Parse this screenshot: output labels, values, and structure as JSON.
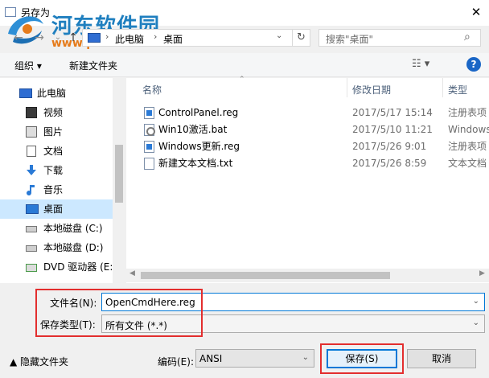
{
  "window": {
    "title": "另存为",
    "close_glyph": "✕"
  },
  "watermark": {
    "name": "河东软件园",
    "url": "www.pc0359.cn"
  },
  "nav": {
    "back_glyph": "←",
    "forward_glyph": "→",
    "up_glyph": "↑",
    "breadcrumb": [
      "此电脑",
      "桌面"
    ],
    "chevron": "›",
    "refresh_glyph": "↻",
    "search_placeholder": "搜索\"桌面\"",
    "search_glyph": "⌕"
  },
  "toolbar": {
    "organize": "组织 ▾",
    "new_folder": "新建文件夹",
    "view_glyph": "☷ ▾",
    "help": "?"
  },
  "sidebar": {
    "items": [
      {
        "label": "此电脑",
        "icon": "computer-icon"
      },
      {
        "label": "视频",
        "icon": "video-icon"
      },
      {
        "label": "图片",
        "icon": "picture-icon"
      },
      {
        "label": "文档",
        "icon": "document-icon"
      },
      {
        "label": "下载",
        "icon": "download-icon"
      },
      {
        "label": "音乐",
        "icon": "music-icon"
      },
      {
        "label": "桌面",
        "icon": "desktop-icon"
      },
      {
        "label": "本地磁盘 (C:)",
        "icon": "drive-icon"
      },
      {
        "label": "本地磁盘 (D:)",
        "icon": "drive-icon"
      },
      {
        "label": "DVD 驱动器 (E:)",
        "icon": "dvd-icon"
      }
    ],
    "selected": "桌面"
  },
  "files": {
    "columns": [
      "名称",
      "修改日期",
      "类型"
    ],
    "rows": [
      {
        "name": "ControlPanel.reg",
        "date": "2017/5/17 15:14",
        "type": "注册表项",
        "icon": "reg"
      },
      {
        "name": "Win10激活.bat",
        "date": "2017/5/10 11:21",
        "type": "Windows",
        "icon": "bat"
      },
      {
        "name": "Windows更新.reg",
        "date": "2017/5/26 9:01",
        "type": "注册表项",
        "icon": "reg"
      },
      {
        "name": "新建文本文档.txt",
        "date": "2017/5/26 8:59",
        "type": "文本文档",
        "icon": "txt"
      }
    ]
  },
  "form": {
    "filename_label": "文件名(N):",
    "filename_value": "OpenCmdHere.reg",
    "filetype_label": "保存类型(T):",
    "filetype_value": "所有文件 (*.*)",
    "dropdown_glyph": "⌄"
  },
  "footer": {
    "hide_folders": "▲  隐藏文件夹",
    "encoding_label": "编码(E):",
    "encoding_value": "ANSI",
    "save": "保存(S)",
    "cancel": "取消"
  },
  "colors": {
    "accent": "#0078d7",
    "highlight_box": "#e32e2e",
    "selection": "#cce8ff"
  }
}
